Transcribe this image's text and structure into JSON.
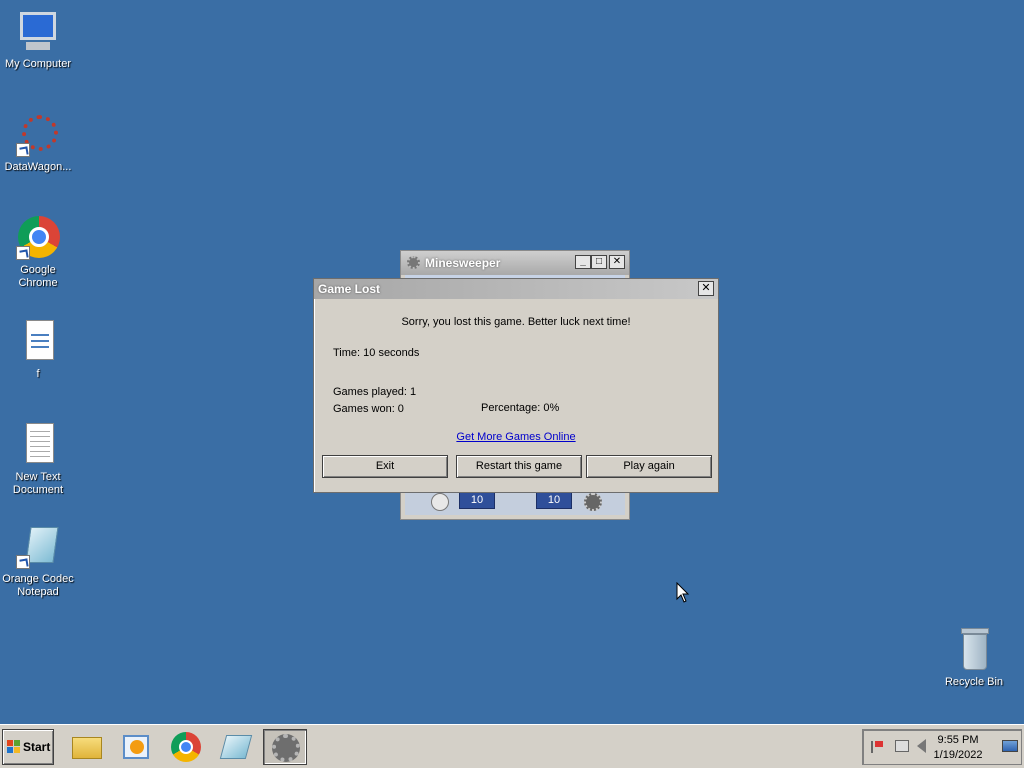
{
  "desktop": {
    "icons": [
      {
        "label": "My Computer"
      },
      {
        "label": "DataWagon..."
      },
      {
        "label": "Google Chrome"
      },
      {
        "label": "f"
      },
      {
        "label": "New Text Document"
      },
      {
        "label": "Orange Codec Notepad"
      },
      {
        "label": "Recycle Bin"
      }
    ]
  },
  "minesweeper": {
    "title": "Minesweeper",
    "time_counter": "10",
    "mines_counter": "10"
  },
  "dialog": {
    "title": "Game Lost",
    "close_label": "✕",
    "message": "Sorry, you lost this game. Better luck next time!",
    "time": "Time: 10 seconds",
    "games_played": "Games played: 1",
    "games_won": "Games won: 0",
    "percentage": "Percentage: 0%",
    "link": "Get More Games Online",
    "buttons": {
      "exit": "Exit",
      "restart": "Restart this game",
      "play_again": "Play again"
    }
  },
  "taskbar": {
    "start_label": "Start",
    "clock_time": "9:55 PM",
    "clock_date": "1/19/2022"
  }
}
